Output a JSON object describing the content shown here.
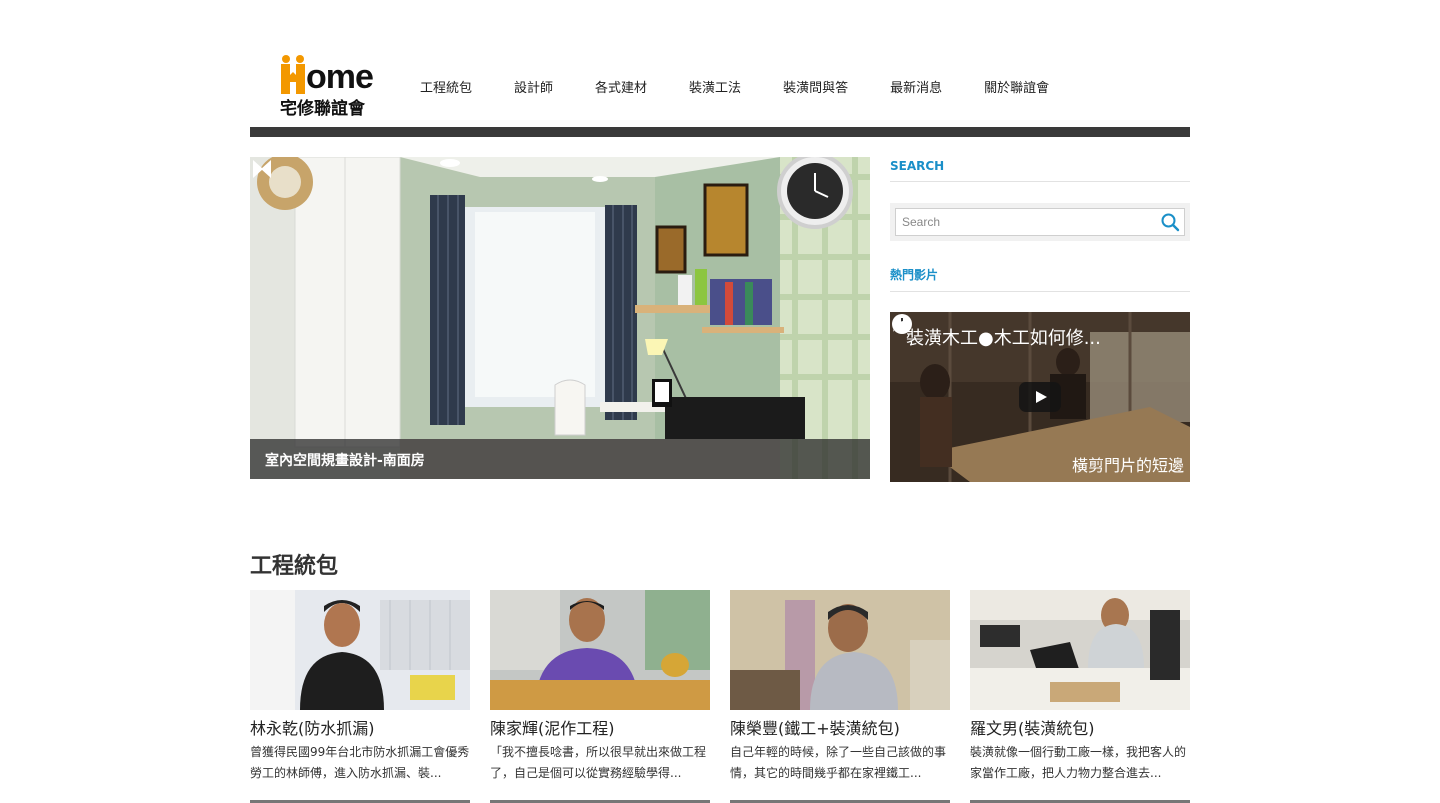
{
  "brand": {
    "logo_word": "ome",
    "logo_subtitle": "宅修聯誼會",
    "logo_colors": {
      "orange": "#f39800",
      "dark": "#111111"
    }
  },
  "nav": {
    "items": [
      {
        "label": "工程統包"
      },
      {
        "label": "設計師"
      },
      {
        "label": "各式建材"
      },
      {
        "label": "裝潢工法"
      },
      {
        "label": "裝潢問與答"
      },
      {
        "label": "最新消息"
      },
      {
        "label": "關於聯誼會"
      }
    ]
  },
  "slider": {
    "caption": "室內空間規畫設計-南面房",
    "prev_icon": "chevron-left-icon",
    "next_icon": "chevron-right-icon"
  },
  "sidebar": {
    "search_heading": "SEARCH",
    "search_placeholder": "Search",
    "video_heading": "熱門影片",
    "video": {
      "title": "裝潢木工●木工如何修...",
      "subtitle_overlay": "橫剪門片的短邊",
      "icons": [
        "clock-icon",
        "share-icon",
        "play-icon"
      ]
    }
  },
  "section": {
    "title": "工程統包",
    "cards": [
      {
        "name": "林永乾(防水抓漏)",
        "desc": "曾獲得民國99年台北市防水抓漏工會優秀勞工的林師傅，進入防水抓漏、裝..."
      },
      {
        "name": "陳家輝(泥作工程)",
        "desc": "「我不擅長唸書，所以很早就出來做工程了，自己是個可以從實務經驗學得..."
      },
      {
        "name": "陳榮豐(鐵工+裝潢統包)",
        "desc": "自己年輕的時候，除了一些自己該做的事情，其它的時間幾乎都在家裡鐵工..."
      },
      {
        "name": "羅文男(裝潢統包)",
        "desc": "裝潢就像一個行動工廠一樣，我把客人的家當作工廠，把人力物力整合進去..."
      }
    ]
  },
  "colors": {
    "accent_blue": "#1a8fc8",
    "header_bar": "#3a3a3a"
  }
}
